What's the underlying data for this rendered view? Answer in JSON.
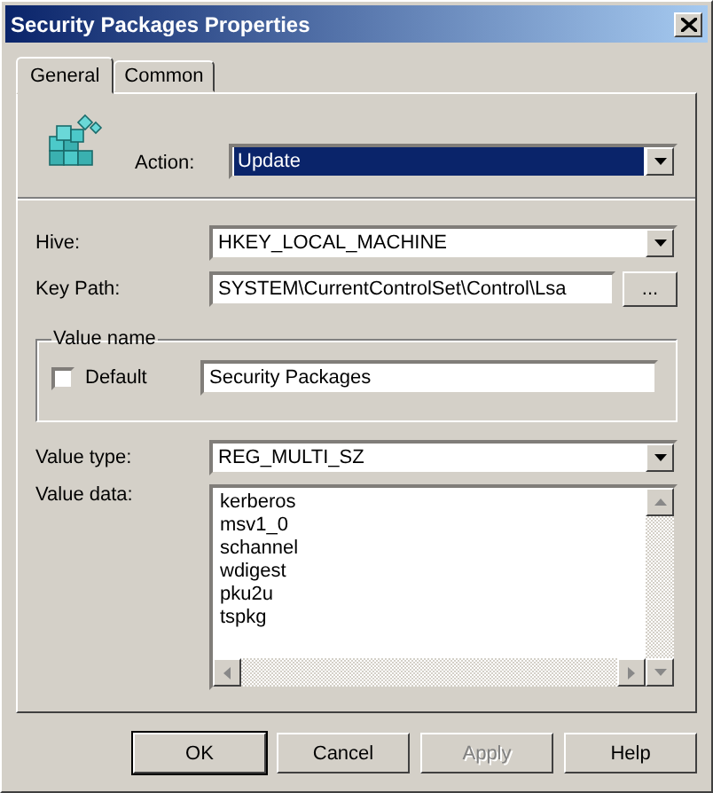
{
  "window": {
    "title": "Security Packages Properties"
  },
  "tabs": [
    {
      "label": "General",
      "selected": true
    },
    {
      "label": "Common",
      "selected": false
    }
  ],
  "action": {
    "label": "Action:",
    "value": "Update",
    "highlighted": true
  },
  "hive": {
    "label": "Hive:",
    "value": "HKEY_LOCAL_MACHINE"
  },
  "key_path": {
    "label": "Key Path:",
    "value": "SYSTEM\\CurrentControlSet\\Control\\Lsa",
    "browse_button": "..."
  },
  "value_name": {
    "legend": "Value name",
    "default_checkbox": {
      "label": "Default",
      "checked": false
    },
    "value": "Security Packages"
  },
  "value_type": {
    "label": "Value type:",
    "value": "REG_MULTI_SZ"
  },
  "value_data": {
    "label": "Value data:",
    "lines": [
      "kerberos",
      "msv1_0",
      "schannel",
      "wdigest",
      "pku2u",
      "tspkg"
    ]
  },
  "buttons": [
    {
      "label": "OK",
      "disabled": false,
      "default": true
    },
    {
      "label": "Cancel",
      "disabled": false,
      "default": false
    },
    {
      "label": "Apply",
      "disabled": true,
      "default": false
    },
    {
      "label": "Help",
      "disabled": false,
      "default": false
    }
  ]
}
